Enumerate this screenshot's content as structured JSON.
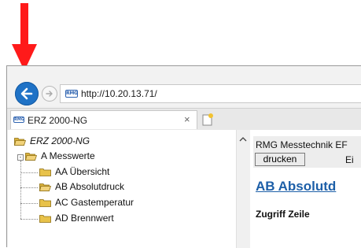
{
  "address_bar": {
    "url": "http://10.20.13.71/",
    "site_logo_text": "RMG"
  },
  "tab": {
    "title": "ERZ 2000-NG",
    "close_glyph": "×",
    "icon_text": "RMG"
  },
  "tree": {
    "root": "ERZ 2000-NG",
    "group": "A Messwerte",
    "items": [
      "AA Übersicht",
      "AB Absolutdruck",
      "AC Gastemperatur",
      "AD Brennwert"
    ]
  },
  "right_pane": {
    "header_title": "RMG Messtechnik EF",
    "print_button": "drucken",
    "header_cut_text": "Ei",
    "heading": "AB Absolutd",
    "subheading": "Zugriff Zeile"
  },
  "colors": {
    "annotation_arrow": "#ff1a1a",
    "back_button": "#1f72c6",
    "heading_link": "#1d5fa8",
    "folder": "#e8c24a"
  },
  "icons": [
    "back-arrow-icon",
    "forward-arrow-icon",
    "rmg-logo-icon",
    "new-tab-icon",
    "folder-icon",
    "scroll-up-icon"
  ]
}
